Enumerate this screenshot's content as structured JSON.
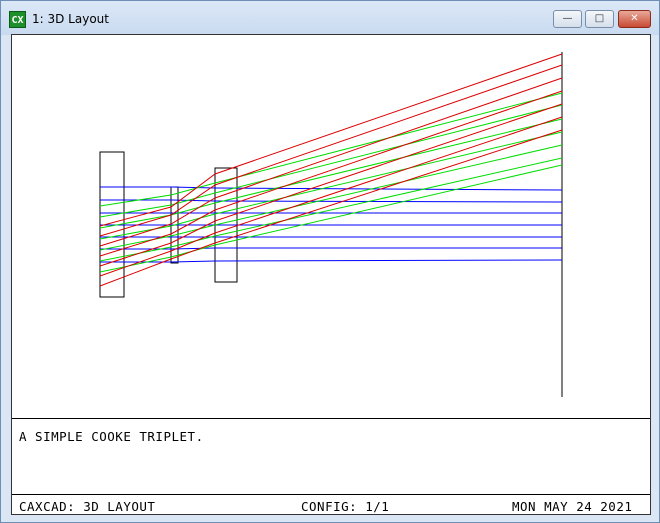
{
  "window": {
    "icon_text": "CX",
    "title": "1: 3D Layout",
    "buttons": {
      "minimize": "—",
      "maximize": "□",
      "close": "✕"
    }
  },
  "caption": "A SIMPLE COOKE TRIPLET.",
  "status": {
    "program": "CAXCAD: 3D LAYOUT",
    "config": "CONFIG: 1/1",
    "date": "MON MAY 24 2021"
  },
  "colors": {
    "field_on_axis": "#0000ff",
    "field_mid": "#00dd00",
    "field_edge": "#dd0000",
    "lens_outline": "#000000"
  }
}
